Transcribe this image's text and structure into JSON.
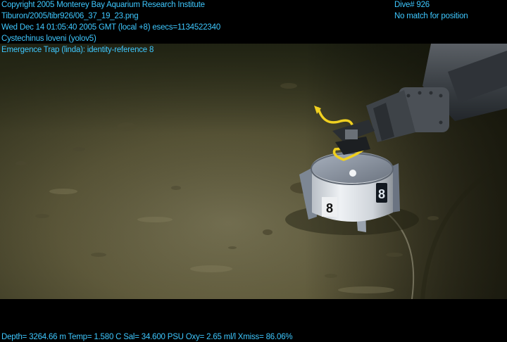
{
  "overlay": {
    "color": "#3ec8ff",
    "copyright": "Copyright 2005 Monterey Bay Aquarium Research Institute",
    "file_path": "Tiburon/2005/tibr926/06_37_19_23.png",
    "timestamp": "Wed Dec 14 01:05:40 2005 GMT (local +8)  esecs=1134522340",
    "species": "Cystechinus loveni (yolov5)",
    "trap": "Emergence Trap (linda): identity-reference 8",
    "dive": "Dive# 926",
    "position_status": "No match for position",
    "telemetry": "Depth= 3264.66 m  Temp= 1.580 C  Sal= 34.600 PSU  Oxy= 2.65 ml/l  Xmiss= 86.06%"
  },
  "scene": {
    "trap_number_front": "8",
    "trap_number_side": "8",
    "seafloor_color": "#5a5535",
    "trap_body_color": "#d8dde4",
    "trap_lid_color": "#8c96a4",
    "manipulator_color": "#3e4348",
    "rope_color": "#f0d020"
  }
}
